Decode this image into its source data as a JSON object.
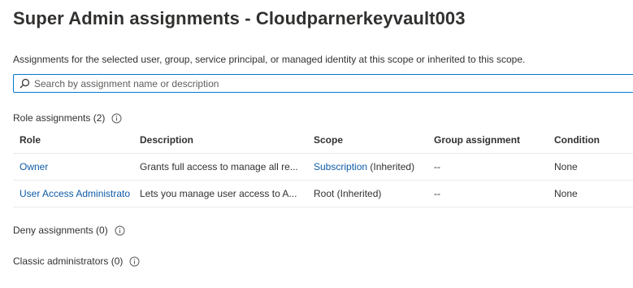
{
  "page": {
    "title": "Super Admin assignments - Cloudparnerkeyvault003",
    "subtitle": "Assignments for the selected user, group, service principal, or managed identity at this scope or inherited to this scope."
  },
  "search": {
    "placeholder": "Search by assignment name or description",
    "value": ""
  },
  "role_assignments": {
    "heading": "Role assignments (2)",
    "columns": {
      "role": "Role",
      "description": "Description",
      "scope": "Scope",
      "group": "Group assignment",
      "condition": "Condition"
    },
    "rows": [
      {
        "role": "Owner",
        "description": "Grants full access to manage all re...",
        "scope_link": "Subscription",
        "scope_suffix": " (Inherited)",
        "group": "--",
        "condition": "None"
      },
      {
        "role": "User Access Administrato",
        "description": "Lets you manage user access to A...",
        "scope_link": "",
        "scope_suffix": "Root (Inherited)",
        "group": "--",
        "condition": "None"
      }
    ]
  },
  "deny_assignments": {
    "heading": "Deny assignments (0)"
  },
  "classic_administrators": {
    "heading": "Classic administrators (0)"
  },
  "icons": {
    "search": "search-icon",
    "info": "info-icon"
  },
  "colors": {
    "accent": "#0078d4",
    "link": "#0f5ba7",
    "text": "#323130",
    "divider": "#edebe9"
  }
}
